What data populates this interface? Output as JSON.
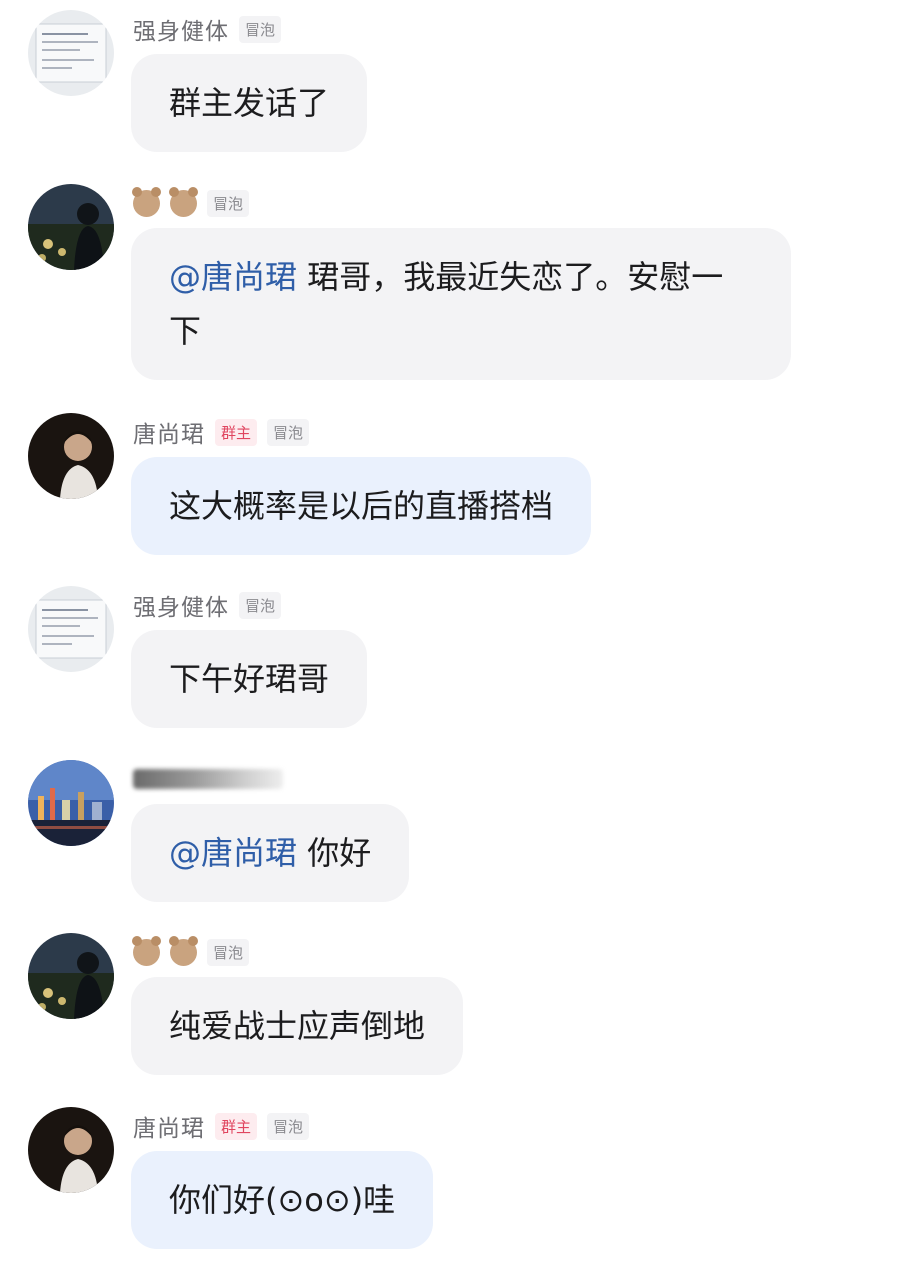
{
  "messages": [
    {
      "name": "强身健体",
      "badges": [
        "冒泡"
      ],
      "text_mention": "",
      "text": "群主发话了",
      "avatar": "document-screenshot-avatar"
    },
    {
      "name": "",
      "name_icons": [
        "bear-emoji",
        "bear-emoji"
      ],
      "badges": [
        "冒泡"
      ],
      "text_mention": "@唐尚珺",
      "text": " 珺哥，我最近失恋了。安慰一下",
      "avatar": "night-silhouette-avatar"
    },
    {
      "name": "唐尚珺",
      "badges": [
        "群主",
        "冒泡"
      ],
      "text_mention": "",
      "text": "这大概率是以后的直播搭档",
      "avatar": "portrait-avatar"
    },
    {
      "name": "强身健体",
      "badges": [
        "冒泡"
      ],
      "text_mention": "",
      "text": "下午好珺哥",
      "avatar": "document-screenshot-avatar"
    },
    {
      "name": "",
      "name_blurred": true,
      "badges": [],
      "text_mention": "@唐尚珺",
      "text": " 你好",
      "avatar": "city-night-avatar"
    },
    {
      "name": "",
      "name_icons": [
        "bear-emoji",
        "bear-emoji"
      ],
      "badges": [
        "冒泡"
      ],
      "text_mention": "",
      "text": "纯爱战士应声倒地",
      "avatar": "night-silhouette-avatar"
    },
    {
      "name": "唐尚珺",
      "badges": [
        "群主",
        "冒泡"
      ],
      "text_mention": "",
      "text": "你们好(⊙o⊙)哇",
      "avatar": "portrait-avatar"
    }
  ],
  "colors": {
    "bubble": "#f3f3f5",
    "owner_bubble": "#eaf1fd",
    "mention": "#2f5ea8",
    "owner_tag": "#e0455f"
  }
}
